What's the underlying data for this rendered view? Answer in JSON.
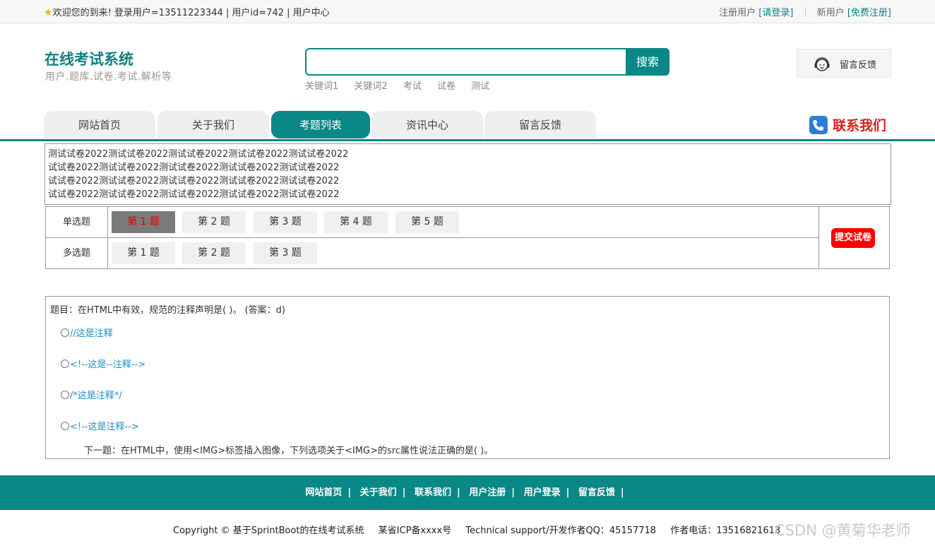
{
  "topbar": {
    "welcome": "欢迎您的到来!  登录用户=13511223344 | 用户id=742 | 用户中心",
    "register_label": "注册用户",
    "login_link": "[请登录]",
    "newuser_label": "新用户",
    "signup_link": "[免费注册]"
  },
  "header": {
    "title": "在线考试系统",
    "subtitle": "用户.题库.试卷.考试.解析等",
    "search_button": "搜索",
    "search_value": "",
    "keywords": [
      "关键词1",
      "关键词2",
      "考试",
      "试卷",
      "测试"
    ],
    "feedback_label": "留言反馈"
  },
  "nav": {
    "tabs": [
      "网站首页",
      "关于我们",
      "考题列表",
      "资讯中心",
      "留言反馈"
    ],
    "active_tab": "考题列表",
    "contact_label": "联系我们"
  },
  "paper": {
    "lines": [
      "测试试卷2022测试试卷2022测试试卷2022测试试卷2022测试试卷2022",
      "试试卷2022测试试卷2022测试试卷2022测试试卷2022测试试卷2022",
      "试试卷2022测试试卷2022测试试卷2022测试试卷2022测试试卷2022",
      "试试卷2022测试试卷2022测试试卷2022测试试卷2022测试试卷2022"
    ]
  },
  "question_grid": {
    "single_label": "单选题",
    "single_items": [
      "第 1 题",
      "第 2 题",
      "第 3 题",
      "第 4 题",
      "第 5 题"
    ],
    "multi_label": "多选题",
    "multi_items": [
      "第 1 题",
      "第 2 题",
      "第 3 题"
    ],
    "submit_label": "提交试卷"
  },
  "question": {
    "title": "题目：在HTML中有效，规范的注释声明是( )。 (答案：d)",
    "options": [
      "//这是注释",
      "<!--这是--注释-->",
      "/*这是注释*/",
      "<!--这是注释-->"
    ],
    "next": "下一题：在HTML中，使用<IMG>标签插入图像，下列选项关于<IMG>的src属性说法正确的是( )。"
  },
  "footer": {
    "links": [
      "网站首页",
      "关于我们",
      "联系我们",
      "用户注册",
      "用户登录",
      "留言反馈"
    ],
    "separator": "|",
    "copyright": "Copyright © 基于SprintBoot的在线考试系统",
    "icp": "某省ICP备xxxx号",
    "support": "Technical support/开发作者QQ：45157718",
    "phone": "作者电话：13516821613",
    "watermark": "CSDN @黄菊华老师"
  },
  "colors": {
    "accent": "#0a8787",
    "danger": "#ff0000",
    "link": "#1a8fc9",
    "active_question_bg": "#7a7a7a"
  }
}
